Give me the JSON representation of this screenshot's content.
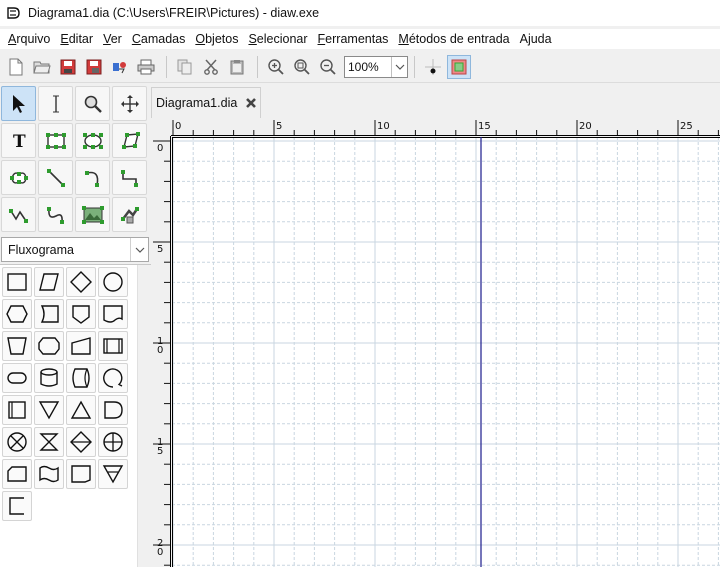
{
  "window": {
    "title": "Diagrama1.dia (C:\\Users\\FREIR\\Pictures) - diaw.exe"
  },
  "menu": {
    "items": [
      {
        "label": "Arquivo",
        "name": "menu-arquivo"
      },
      {
        "label": "Editar",
        "name": "menu-editar"
      },
      {
        "label": "Ver",
        "name": "menu-ver"
      },
      {
        "label": "Camadas",
        "name": "menu-camadas"
      },
      {
        "label": "Objetos",
        "name": "menu-objetos"
      },
      {
        "label": "Selecionar",
        "name": "menu-selecionar"
      },
      {
        "label": "Ferramentas",
        "name": "menu-ferramentas"
      },
      {
        "label": "Métodos de entrada",
        "name": "menu-metodos-de-entrada"
      },
      {
        "label": "Ajuda",
        "name": "menu-ajuda"
      }
    ]
  },
  "toolbar": {
    "zoom_value": "100%",
    "icons": [
      "new-file-icon",
      "open-folder-icon",
      "save-icon",
      "save-as-icon",
      "export-icon",
      "print-icon",
      "copy-icon",
      "cut-icon",
      "paste-icon",
      "zoom-in-icon",
      "zoom-fit-icon",
      "zoom-out-icon",
      "snap-to-grid-icon",
      "snap-to-objects-icon"
    ]
  },
  "tools": [
    "pointer",
    "text-edit",
    "magnify",
    "scroll",
    "text",
    "box",
    "ellipse",
    "polygon",
    "beziergon",
    "line",
    "arc",
    "zigzag-line",
    "polyline",
    "bezier-line",
    "image",
    "outline"
  ],
  "sheet": {
    "selected": "Fluxograma"
  },
  "shapes": [
    "process",
    "input-output",
    "decision",
    "connector",
    "preparation",
    "delay",
    "off-page-connector",
    "document",
    "manual-operation",
    "terminal",
    "manual-input",
    "predefined-process",
    "terminator",
    "magnetic-disk",
    "direct-access-storage",
    "sequential-access-storage",
    "internal-storage",
    "merge",
    "extract",
    "delay-2",
    "summing-junction",
    "collate",
    "sort",
    "or",
    "punched-card",
    "punched-tape",
    "transaction-file",
    "offline-storage",
    "annotation"
  ],
  "document": {
    "tab_label": "Diagrama1.dia"
  },
  "rulers": {
    "top_labels": [
      "0",
      "5",
      "10",
      "15",
      "20",
      "25"
    ],
    "left_labels": [
      "0",
      "5",
      "10",
      "15",
      "20"
    ]
  },
  "colors": {
    "grid": "#c9d6e0",
    "guide_line": "#1c1c8c",
    "selected_tool": "#cde3f7"
  }
}
